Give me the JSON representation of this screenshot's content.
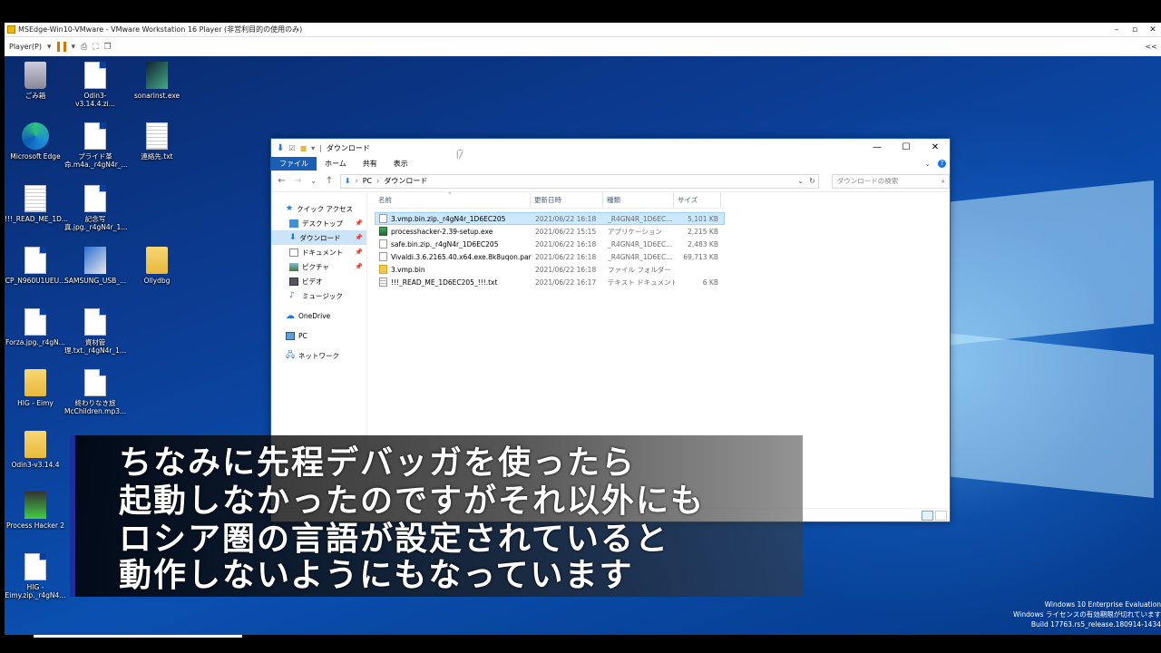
{
  "vmware": {
    "title": "MSEdge-Win10-VMware - VMware Workstation 16 Player (非営利目的の使用のみ)",
    "player_menu": "Player(P)",
    "collapse_label": "<<"
  },
  "desktop": {
    "icons": [
      {
        "label": "ごみ箱",
        "icon": "recycle-bin-icon"
      },
      {
        "label": "Odin3-v3.14.4.zi...",
        "icon": "file-icon"
      },
      {
        "label": "sonarinst.exe",
        "icon": "app-icon"
      },
      {
        "label": "Microsoft Edge",
        "icon": "edge-icon"
      },
      {
        "label": "プライド革命.m4a._r4gN4r_...",
        "icon": "file-icon"
      },
      {
        "label": "連絡先.txt",
        "icon": "text-file-icon"
      },
      {
        "label": "!!!_READ_ME_1D...",
        "icon": "text-file-icon"
      },
      {
        "label": "記念写真.jpg._r4gN4r_1...",
        "icon": "file-icon"
      },
      {
        "label": "CP_N960U1UEU...",
        "icon": "file-icon"
      },
      {
        "label": "SAMSUNG_USB_...",
        "icon": "installer-icon"
      },
      {
        "label": "Ollydbg",
        "icon": "folder-icon"
      },
      {
        "label": "Forza.jpg._r4gN...",
        "icon": "file-icon"
      },
      {
        "label": "資材管理.txt._r4gN4r_1...",
        "icon": "file-icon"
      },
      {
        "label": "HIG - Eimy",
        "icon": "folder-icon"
      },
      {
        "label": "終わりなき旅McChildren.mp3...",
        "icon": "file-icon"
      },
      {
        "label": "Odin3-v3.14.4",
        "icon": "folder-icon"
      },
      {
        "label": "Process Hacker 2",
        "icon": "process-hacker-icon"
      },
      {
        "label": "HIG - Eimy.zip._r4gN4...",
        "icon": "file-icon"
      }
    ],
    "watermark": {
      "line1": "Windows 10 Enterprise Evaluation",
      "line2": "Windows ライセンスの有効期限が切れています",
      "line3": "Build 17763.rs5_release.180914-1434"
    }
  },
  "explorer": {
    "title": "ダウンロード",
    "ribbon_tabs": [
      "ファイル",
      "ホーム",
      "共有",
      "表示"
    ],
    "address": {
      "segments": [
        "PC",
        "ダウンロード"
      ]
    },
    "search_placeholder": "ダウンロードの検索",
    "nav_pane": {
      "quick_access": "クイック アクセス",
      "items": [
        "デスクトップ",
        "ダウンロード",
        "ドキュメント",
        "ピクチャ",
        "ビデオ",
        "ミュージック"
      ],
      "onedrive": "OneDrive",
      "pc": "PC",
      "network": "ネットワーク"
    },
    "columns": {
      "name": "名前",
      "date": "更新日時",
      "type": "種類",
      "size": "サイズ"
    },
    "files": [
      {
        "name": "3.vmp.bin.zip._r4gN4r_1D6EC205",
        "date": "2021/06/22 16:18",
        "type": "_R4GN4R_1D6EC...",
        "size": "5,101 KB",
        "icon": "file",
        "selected": true
      },
      {
        "name": "processhacker-2.39-setup.exe",
        "date": "2021/06/22 15:15",
        "type": "アプリケーション",
        "size": "2,215 KB",
        "icon": "app",
        "selected": false
      },
      {
        "name": "safe.bin.zip._r4gN4r_1D6EC205",
        "date": "2021/06/22 16:18",
        "type": "_R4GN4R_1D6EC...",
        "size": "2,483 KB",
        "icon": "file",
        "selected": false
      },
      {
        "name": "Vivaldi.3.6.2165.40.x64.exe.8k8uqon.parti...",
        "date": "2021/06/22 16:18",
        "type": "_R4GN4R_1D6EC...",
        "size": "69,713 KB",
        "icon": "file",
        "selected": false
      },
      {
        "name": "3.vmp.bin",
        "date": "2021/06/22 16:18",
        "type": "ファイル フォルダー",
        "size": "",
        "icon": "folder",
        "selected": false
      },
      {
        "name": "!!!_READ_ME_1D6EC205_!!!.txt",
        "date": "2021/06/22 16:17",
        "type": "テキスト ドキュメント",
        "size": "6 KB",
        "icon": "txt",
        "selected": false
      }
    ]
  },
  "subtitle": {
    "line1": "ちなみに先程デバッガを使ったら",
    "line2": "起動しなかったのですがそれ以外にも",
    "line3": "ロシア圏の言語が設定されていると",
    "line4": "動作しないようにもなっています"
  }
}
